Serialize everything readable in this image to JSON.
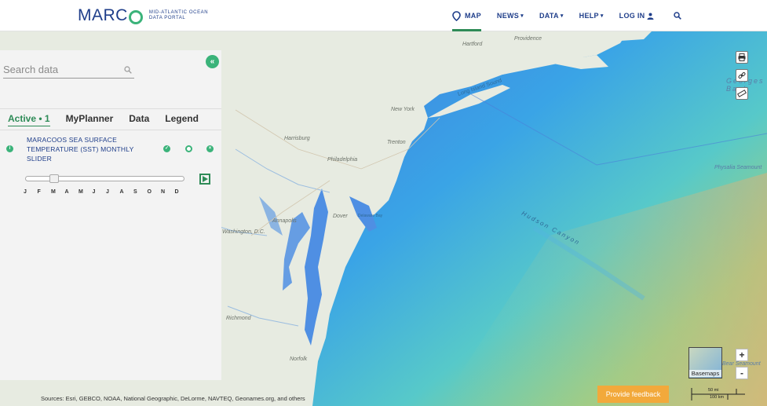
{
  "header": {
    "brand": "MARC",
    "brand_sub_1": "Mid-Atlantic Ocean",
    "brand_sub_2": "Data Portal",
    "nav": {
      "map": "MAP",
      "news": "NEWS",
      "data": "DATA",
      "help": "HELP",
      "login": "LOG IN"
    }
  },
  "panel": {
    "search_placeholder": "Search data",
    "tabs": [
      "Active • 1",
      "MyPlanner",
      "Data",
      "Legend"
    ],
    "layer_title": "MARACOOS SEA SURFACE TEMPERATURE (SST) MONTHLY SLIDER",
    "months": [
      "J",
      "F",
      "M",
      "A",
      "M",
      "J",
      "J",
      "A",
      "S",
      "O",
      "N",
      "D"
    ],
    "slider_position_fraction": 0.16
  },
  "map": {
    "labels": {
      "providence": "Providence",
      "hartford": "Hartford",
      "long_island_sound": "Long Island Sound",
      "new_york": "New York",
      "harrisburg": "Harrisburg",
      "trenton": "Trenton",
      "philadelphia": "Philadelphia",
      "annapolis": "Annapolis",
      "washington": "Washington, D.C.",
      "dover": "Dover",
      "delaware_bay": "Delaware Bay",
      "richmond": "Richmond",
      "norfolk": "Norfolk",
      "hudson_canyon": "Hudson Canyon",
      "georges_bank": "Georges Bank",
      "physalia_seamount": "Physalia Seamount",
      "bear_seamount": "Bear Seamount"
    },
    "zoom_in": "+",
    "zoom_out": "-",
    "basemaps": "Basemaps",
    "feedback": "Provide feedback",
    "scale_mi": "50 mi",
    "scale_km": "100 km",
    "attribution": "Sources: Esri, GEBCO, NOAA, National Geographic, DeLorme, NAVTEQ, Geonames.org, and others"
  },
  "colors": {
    "brand_blue": "#1f3e8a",
    "brand_green": "#3bb37a",
    "feedback_orange": "#f2a93b"
  }
}
